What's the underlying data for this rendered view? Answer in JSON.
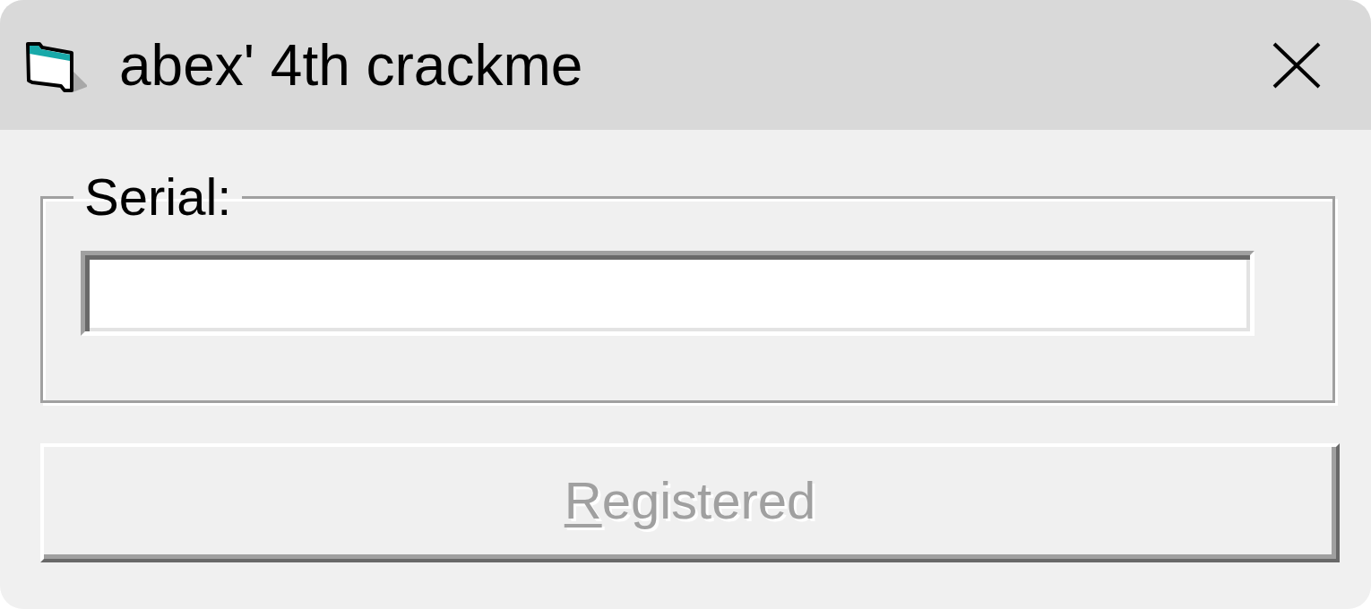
{
  "window": {
    "title": "abex' 4th crackme"
  },
  "serial_group": {
    "label": "Serial:"
  },
  "register_button": {
    "label": "Registered",
    "disabled": true,
    "access_key_underlined": true
  }
}
